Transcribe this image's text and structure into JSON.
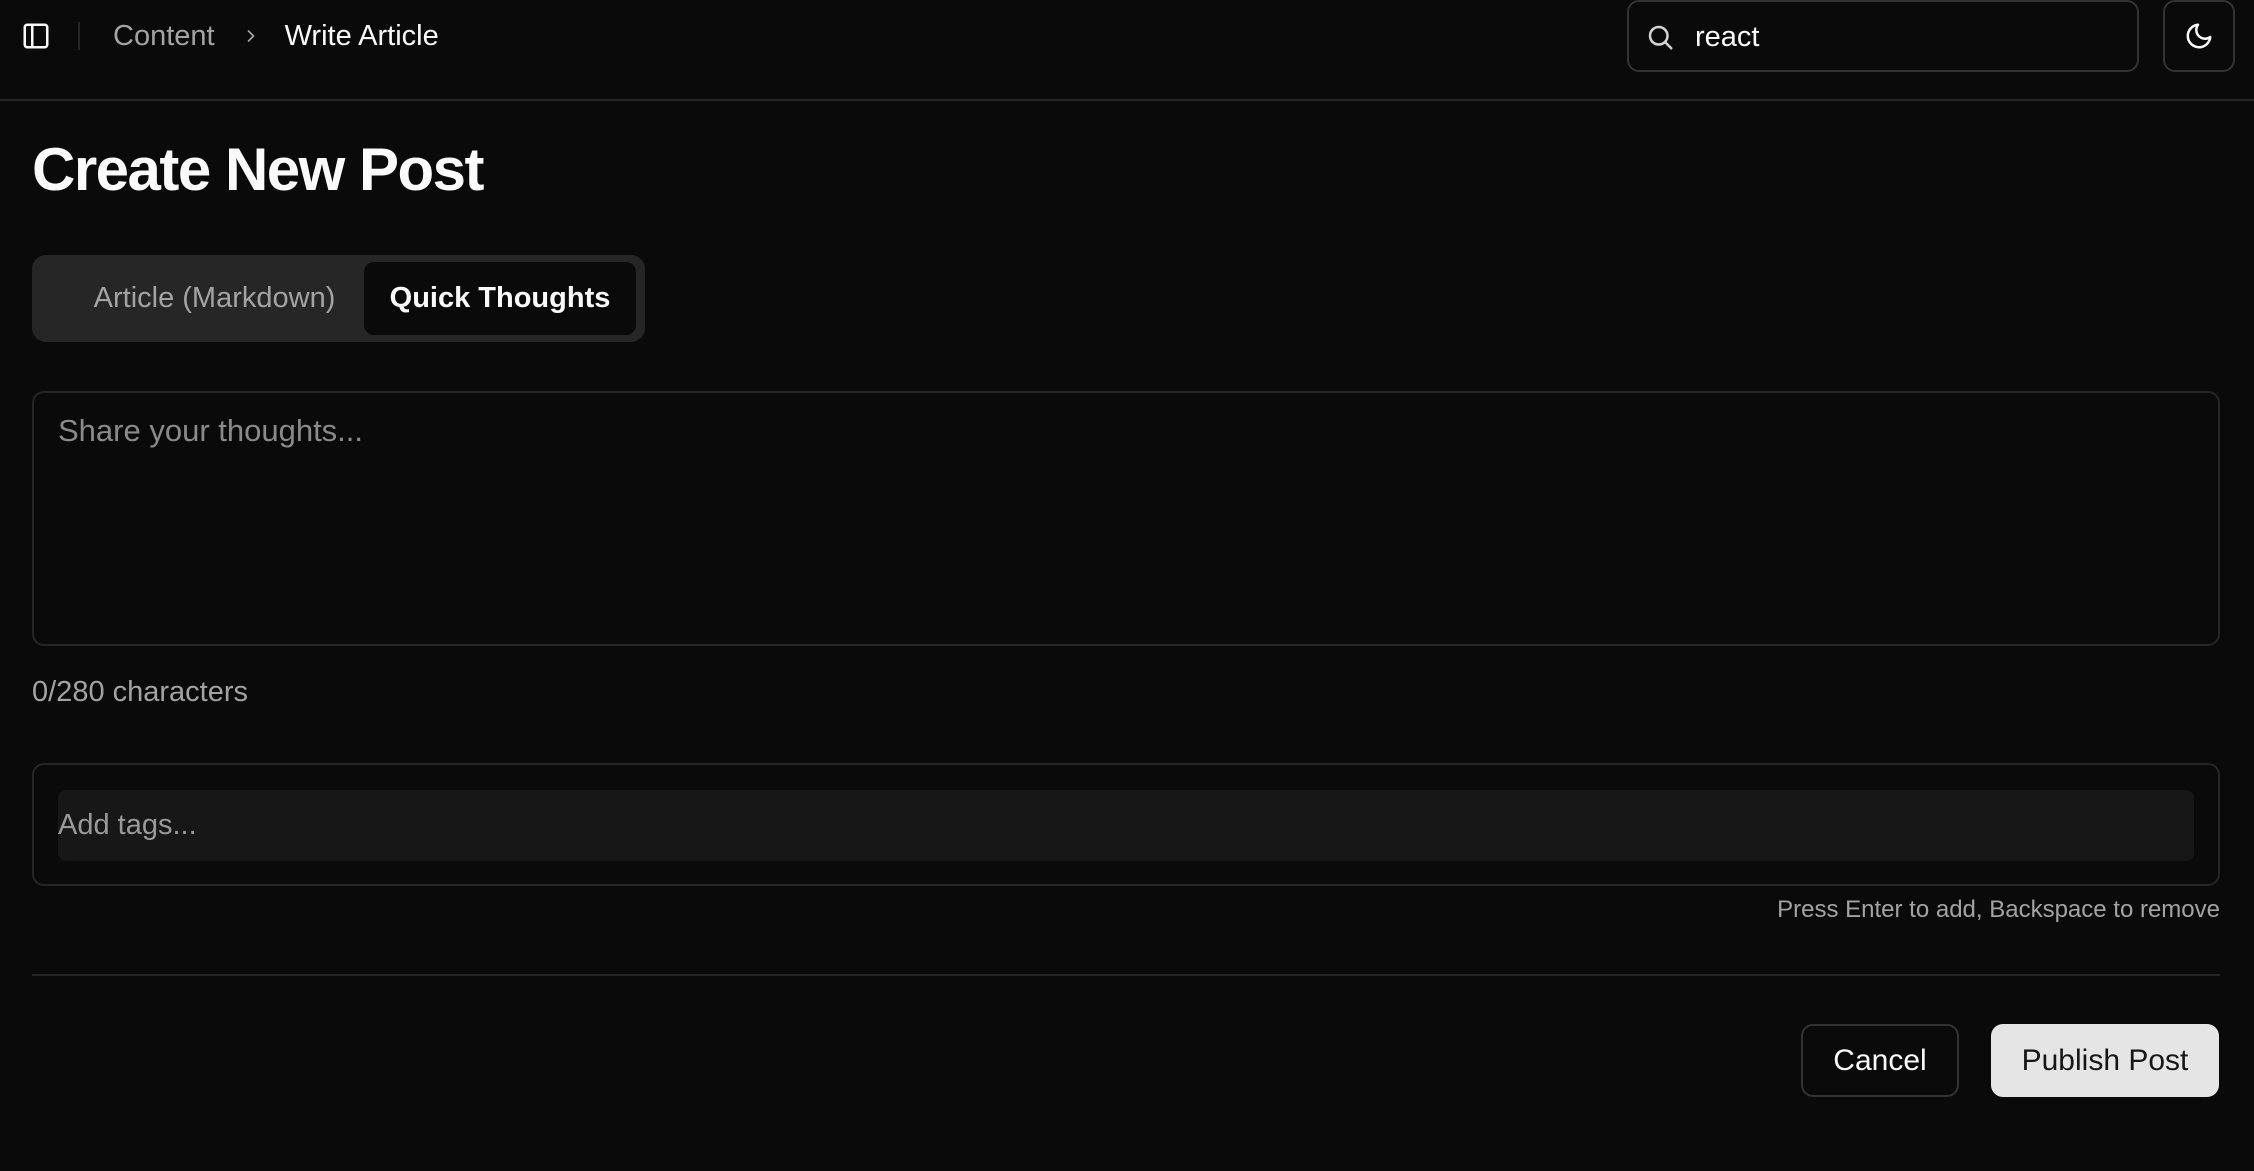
{
  "header": {
    "breadcrumb": {
      "parent": "Content",
      "current": "Write Article"
    },
    "search": {
      "value": "react"
    },
    "icons": {
      "sidebar": "panel-left-icon",
      "search": "search-icon",
      "theme": "moon-icon",
      "separator": "chevron-right-icon"
    }
  },
  "main": {
    "title": "Create New Post",
    "tabs": [
      {
        "label": "Article (Markdown)",
        "active": false
      },
      {
        "label": "Quick Thoughts",
        "active": true
      }
    ],
    "thoughts": {
      "placeholder": "Share your thoughts...",
      "value": ""
    },
    "char_count": "0/280 characters",
    "tags": {
      "placeholder": "Add tags...",
      "hint": "Press Enter to add, Backspace to remove"
    }
  },
  "footer": {
    "cancel_label": "Cancel",
    "publish_label": "Publish Post"
  },
  "colors": {
    "background": "#0a0a0a",
    "border": "#262626",
    "muted_text": "#a3a3a3",
    "primary_button": "#e5e5e5"
  }
}
